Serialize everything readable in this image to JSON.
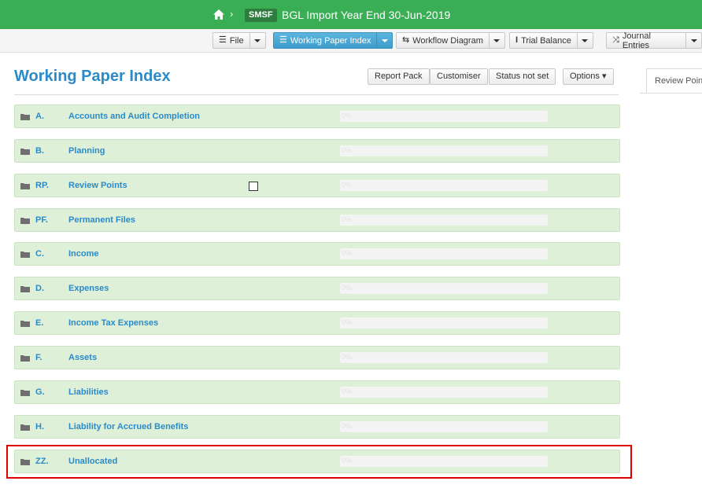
{
  "topbar": {
    "badge": "SMSF",
    "title": "BGL Import  Year End 30-Jun-2019"
  },
  "toolbar": {
    "buttons": [
      {
        "label": "File",
        "icon": "list-icon",
        "active": false
      },
      {
        "label": "Working Paper Index",
        "icon": "list-icon",
        "active": true
      },
      {
        "label": "Workflow Diagram",
        "icon": "workflow-icon",
        "active": false
      },
      {
        "label": "Trial Balance",
        "icon": "text-height-icon",
        "active": false
      },
      {
        "label": "Journal Entries",
        "icon": "shuffle-icon",
        "active": false
      }
    ]
  },
  "page": {
    "title": "Working Paper Index",
    "buttons": {
      "report_pack": "Report Pack",
      "customiser": "Customiser",
      "status": "Status not set",
      "options": "Options ▾"
    },
    "side_tab": "Review Points"
  },
  "rows": [
    {
      "code": "A.",
      "name": "Accounts and Audit Completion",
      "progress": "0%"
    },
    {
      "code": "B.",
      "name": "Planning",
      "progress": "0%"
    },
    {
      "code": "RP.",
      "name": "Review Points",
      "progress": "0%",
      "checkbox": true
    },
    {
      "code": "PF.",
      "name": "Permanent Files",
      "progress": "0%"
    },
    {
      "code": "C.",
      "name": "Income",
      "progress": "0%"
    },
    {
      "code": "D.",
      "name": "Expenses",
      "progress": "0%"
    },
    {
      "code": "E.",
      "name": "Income Tax Expenses",
      "progress": "0%"
    },
    {
      "code": "F.",
      "name": "Assets",
      "progress": "0%"
    },
    {
      "code": "G.",
      "name": "Liabilities",
      "progress": "0%"
    },
    {
      "code": "H.",
      "name": "Liability for Accrued Benefits",
      "progress": "0%"
    },
    {
      "code": "ZZ.",
      "name": "Unallocated",
      "progress": "0%"
    }
  ],
  "colors": {
    "topbar": "#3aae55",
    "accent": "#2b8ac7",
    "row_bg": "#dff0d8",
    "highlight": "#e00000"
  }
}
